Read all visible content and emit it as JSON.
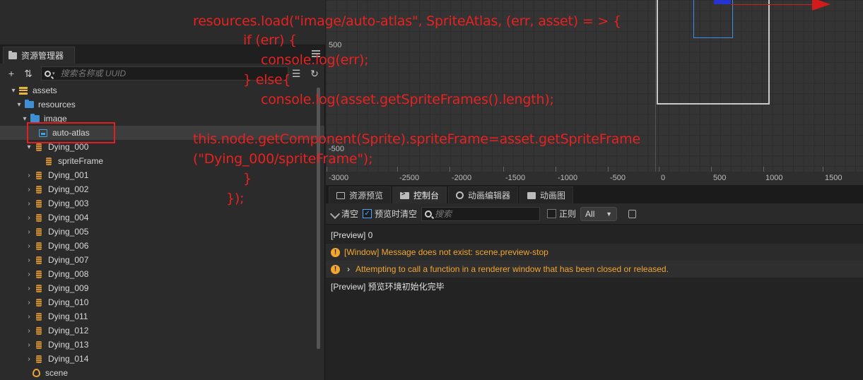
{
  "asset_panel": {
    "tab_title": "资源管理器",
    "search_placeholder": "搜索名称或 UUID",
    "tree": [
      {
        "label": "assets",
        "icon": "database-icon",
        "arrow": "▾"
      },
      {
        "label": "resources",
        "icon": "folder-icon",
        "arrow": "▾"
      },
      {
        "label": "image",
        "icon": "folder-icon",
        "arrow": "▾"
      },
      {
        "label": "auto-atlas",
        "icon": "sprite-atlas-icon",
        "arrow": ""
      },
      {
        "label": "Dying_000",
        "icon": "sprite-frame-icon",
        "arrow": "▾"
      },
      {
        "label": "spriteFrame",
        "icon": "sprite-frame-icon",
        "arrow": ""
      },
      {
        "label": "Dying_001",
        "icon": "sprite-frame-icon",
        "arrow": "›"
      },
      {
        "label": "Dying_002",
        "icon": "sprite-frame-icon",
        "arrow": "›"
      },
      {
        "label": "Dying_003",
        "icon": "sprite-frame-icon",
        "arrow": "›"
      },
      {
        "label": "Dying_004",
        "icon": "sprite-frame-icon",
        "arrow": "›"
      },
      {
        "label": "Dying_005",
        "icon": "sprite-frame-icon",
        "arrow": "›"
      },
      {
        "label": "Dying_006",
        "icon": "sprite-frame-icon",
        "arrow": "›"
      },
      {
        "label": "Dying_007",
        "icon": "sprite-frame-icon",
        "arrow": "›"
      },
      {
        "label": "Dying_008",
        "icon": "sprite-frame-icon",
        "arrow": "›"
      },
      {
        "label": "Dying_009",
        "icon": "sprite-frame-icon",
        "arrow": "›"
      },
      {
        "label": "Dying_010",
        "icon": "sprite-frame-icon",
        "arrow": "›"
      },
      {
        "label": "Dying_011",
        "icon": "sprite-frame-icon",
        "arrow": "›"
      },
      {
        "label": "Dying_012",
        "icon": "sprite-frame-icon",
        "arrow": "›"
      },
      {
        "label": "Dying_013",
        "icon": "sprite-frame-icon",
        "arrow": "›"
      },
      {
        "label": "Dying_014",
        "icon": "sprite-frame-icon",
        "arrow": "›"
      },
      {
        "label": "scene",
        "icon": "scene-icon",
        "arrow": ""
      }
    ]
  },
  "scene_view": {
    "y_labels": [
      "500",
      "-500"
    ],
    "x_labels": [
      "-3000",
      "-2500",
      "-2000",
      "-1500",
      "-1000",
      "-500",
      "0",
      "500",
      "1000",
      "1500"
    ]
  },
  "console": {
    "tabs": [
      "资源预览",
      "控制台",
      "动画编辑器",
      "动画图"
    ],
    "active_tab": "控制台",
    "toolbar": {
      "clear": "清空",
      "clear_on_preview": "预览时清空",
      "search_placeholder": "搜索",
      "regex": "正则",
      "level": "All"
    },
    "logs": [
      {
        "type": "info",
        "text": "[Preview] 0"
      },
      {
        "type": "warn",
        "text": "[Window] Message does not exist: scene.preview-stop"
      },
      {
        "type": "warn",
        "text": "Attempting to call a function in a renderer window that has been closed or released."
      },
      {
        "type": "info",
        "text": "[Preview] 预览环境初始化完毕"
      }
    ]
  },
  "annotation": {
    "lines": [
      "resources.load(\"image/auto-atlas\", SpriteAtlas, (err, asset) = > {",
      "if (err) {",
      "console.log(err);",
      "}  else{",
      "console.log(asset.getSpriteFrames().length);",
      "this.node.getComponent(Sprite).spriteFrame=asset.getSpriteFrame",
      "(\"Dying_000/spriteFrame\");",
      "}",
      "});"
    ],
    "color": "#e82121"
  },
  "colors": {
    "warning": "#f2a530",
    "highlight_box": "#e02020",
    "folder": "#3d8fd6"
  }
}
